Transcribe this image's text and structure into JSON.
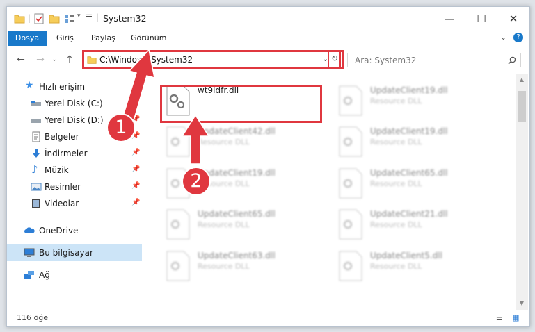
{
  "window": {
    "title": "System32"
  },
  "ribbon": {
    "tabs": [
      "Dosya",
      "Giriş",
      "Paylaş",
      "Görünüm"
    ]
  },
  "address": {
    "path": "C:\\Windows\\System32"
  },
  "search": {
    "placeholder": "Ara: System32"
  },
  "sidebar": {
    "items": [
      {
        "label": "Hızlı erişim",
        "icon": "star-icon"
      },
      {
        "label": "Yerel Disk (C:)",
        "icon": "drive-icon",
        "pinned": true
      },
      {
        "label": "Yerel Disk (D:)",
        "icon": "drive-icon",
        "pinned": true
      },
      {
        "label": "Belgeler",
        "icon": "documents-icon",
        "pinned": true
      },
      {
        "label": "İndirmeler",
        "icon": "download-icon",
        "pinned": true
      },
      {
        "label": "Müzik",
        "icon": "music-icon",
        "pinned": true
      },
      {
        "label": "Resimler",
        "icon": "pictures-icon",
        "pinned": true
      },
      {
        "label": "Videolar",
        "icon": "video-icon",
        "pinned": true
      },
      {
        "label": "OneDrive",
        "icon": "cloud-icon"
      },
      {
        "label": "Bu bilgisayar",
        "icon": "computer-icon",
        "selected": true
      },
      {
        "label": "Ağ",
        "icon": "network-icon"
      }
    ]
  },
  "files": {
    "left": [
      {
        "name": "wt9ldfr.dll",
        "type": ""
      },
      {
        "name": "UpdateClient42.dll",
        "type": "Resource DLL"
      },
      {
        "name": "UpdateClient19.dll",
        "type": "Resource DLL"
      },
      {
        "name": "UpdateClient65.dll",
        "type": "Resource DLL"
      },
      {
        "name": "UpdateClient63.dll",
        "type": "Resource DLL"
      }
    ],
    "right": [
      {
        "name": "UpdateClient19.dll",
        "type": "Resource DLL"
      },
      {
        "name": "UpdateClient19.dll",
        "type": "Resource DLL"
      },
      {
        "name": "UpdateClient65.dll",
        "type": "Resource DLL"
      },
      {
        "name": "UpdateClient21.dll",
        "type": "Resource DLL"
      },
      {
        "name": "UpdateClient5.dll",
        "type": "Resource DLL"
      }
    ]
  },
  "status": {
    "count": "116 öğe"
  },
  "annotations": {
    "step1": "1",
    "step2": "2"
  },
  "colors": {
    "accent": "#1979ca",
    "annotation": "#e0373f",
    "selection": "#cce4f7"
  }
}
